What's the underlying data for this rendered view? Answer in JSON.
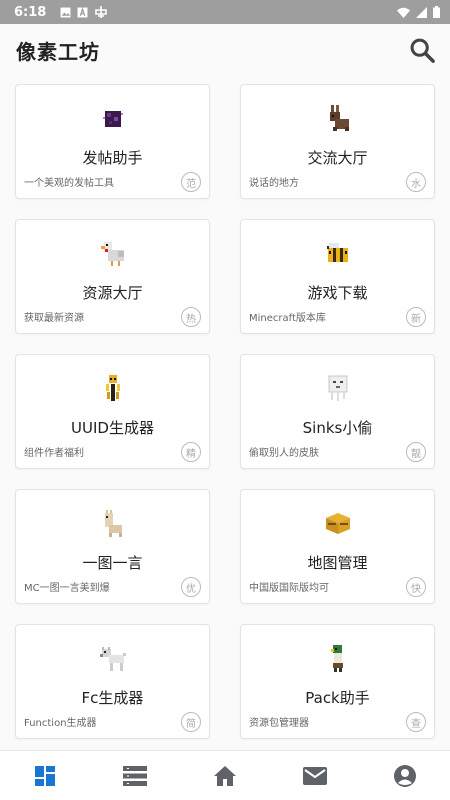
{
  "status_bar": {
    "time": "6:18",
    "left_icons": [
      "image-icon",
      "a-icon",
      "app-logo-icon"
    ],
    "right_icons": [
      "wifi-icon",
      "signal-icon",
      "battery-icon"
    ]
  },
  "app_bar": {
    "title": "像素工坊",
    "search_icon": "search-icon"
  },
  "cards": [
    {
      "name": "发帖助手",
      "desc": "一个美观的发帖工具",
      "badge": "范",
      "art": "ender-block"
    },
    {
      "name": "交流大厅",
      "desc": "说话的地方",
      "badge": "水",
      "art": "rabbit"
    },
    {
      "name": "资源大厅",
      "desc": "获取最新资源",
      "badge": "热",
      "art": "chicken"
    },
    {
      "name": "游戏下载",
      "desc": "Minecraft版本库",
      "badge": "新",
      "art": "bee"
    },
    {
      "name": "UUID生成器",
      "desc": "组件作者福利",
      "badge": "精",
      "art": "blaze"
    },
    {
      "name": "Sinks小偷",
      "desc": "偷取别人的皮肤",
      "badge": "靓",
      "art": "ghast"
    },
    {
      "name": "一图一言",
      "desc": "MC一图一言美到爆",
      "badge": "优",
      "art": "llama"
    },
    {
      "name": "地图管理",
      "desc": "中国版国际版均可",
      "badge": "快",
      "art": "hay-block"
    },
    {
      "name": "Fc生成器",
      "desc": "Function生成器",
      "badge": "简",
      "art": "wolf"
    },
    {
      "name": "Pack助手",
      "desc": "资源包管理器",
      "badge": "查",
      "art": "duck-villager"
    }
  ],
  "bottom_nav": [
    {
      "icon": "dashboard-icon",
      "active": true
    },
    {
      "icon": "list-icon",
      "active": false
    },
    {
      "icon": "home-icon",
      "active": false
    },
    {
      "icon": "mail-icon",
      "active": false
    },
    {
      "icon": "account-icon",
      "active": false
    }
  ],
  "colors": {
    "status_bar": "#9e9e9e",
    "nav_active": "#1976d2",
    "nav_inactive": "#5f6368",
    "card_border": "#e3e3e3"
  }
}
